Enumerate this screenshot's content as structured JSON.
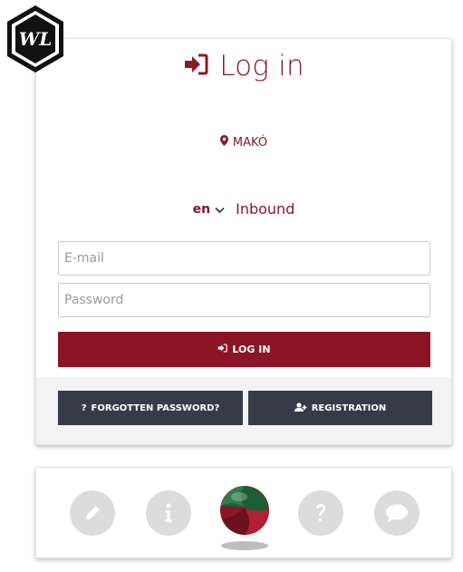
{
  "brand": {
    "logo_text": "WL"
  },
  "login": {
    "title": "Log in",
    "location": "MAKÓ",
    "language": "en",
    "direction": "Inbound",
    "email_placeholder": "E-mail",
    "password_placeholder": "Password",
    "login_button": "LOG IN",
    "forgot_button": "FORGOTTEN PASSWORD?",
    "register_button": "REGISTRATION"
  },
  "footer": {
    "icons": [
      "pencil-icon",
      "info-icon",
      "app-logo",
      "question-icon",
      "chat-icon"
    ]
  },
  "colors": {
    "accent": "#8b1a28",
    "dark_button": "#363b47",
    "icon_circle": "#dcdcdc"
  }
}
